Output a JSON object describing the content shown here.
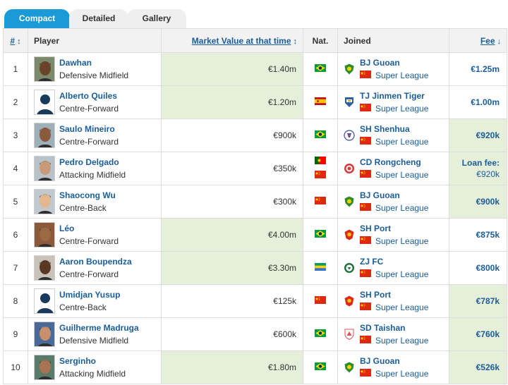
{
  "tabs": [
    {
      "label": "Compact"
    },
    {
      "label": "Detailed"
    },
    {
      "label": "Gallery"
    }
  ],
  "columns": {
    "num": "#",
    "player": "Player",
    "market_value": "Market Value at that time",
    "nat": "Nat.",
    "joined": "Joined",
    "fee": "Fee"
  },
  "sort_icons": {
    "num": "↕",
    "market_value": "↕",
    "fee": "↓"
  },
  "colors": {
    "accent": "#1a9bd7",
    "link": "#1a5d9a",
    "highlight": "#e5efd9",
    "header_bg": "#f2f2f2"
  },
  "rows": [
    {
      "num": "1",
      "name": "Dawhan",
      "position": "Defensive Midfield",
      "market_value": "€1.40m",
      "mv_hl": true,
      "nat": [
        "brazil"
      ],
      "club": "BJ Guoan",
      "crest": "guoan-crest",
      "league": "Super League",
      "fee": "€1.25m",
      "fee_hl": false
    },
    {
      "num": "2",
      "name": "Alberto Quiles",
      "position": "Centre-Forward",
      "market_value": "€1.20m",
      "mv_hl": true,
      "nat": [
        "spain"
      ],
      "club": "TJ Jinmen Tiger",
      "crest": "jinmen-tiger-crest",
      "league": "Super League",
      "fee": "€1.00m",
      "fee_hl": false
    },
    {
      "num": "3",
      "name": "Saulo Mineiro",
      "position": "Centre-Forward",
      "market_value": "€900k",
      "mv_hl": false,
      "nat": [
        "brazil"
      ],
      "club": "SH Shenhua",
      "crest": "shenhua-crest",
      "league": "Super League",
      "fee": "€920k",
      "fee_hl": true
    },
    {
      "num": "4",
      "name": "Pedro Delgado",
      "position": "Attacking Midfield",
      "market_value": "€350k",
      "mv_hl": false,
      "nat": [
        "portugal",
        "china"
      ],
      "club": "CD Rongcheng",
      "crest": "rongcheng-crest",
      "league": "Super League",
      "fee_label": "Loan fee:",
      "fee": "€920k",
      "fee_hl": true
    },
    {
      "num": "5",
      "name": "Shaocong Wu",
      "position": "Centre-Back",
      "market_value": "€300k",
      "mv_hl": false,
      "nat": [
        "china"
      ],
      "club": "BJ Guoan",
      "crest": "guoan-crest",
      "league": "Super League",
      "fee": "€900k",
      "fee_hl": true
    },
    {
      "num": "6",
      "name": "Léo",
      "position": "Centre-Forward",
      "market_value": "€4.00m",
      "mv_hl": true,
      "nat": [
        "brazil"
      ],
      "club": "SH Port",
      "crest": "sh-port-crest",
      "league": "Super League",
      "fee": "€875k",
      "fee_hl": false
    },
    {
      "num": "7",
      "name": "Aaron Boupendza",
      "position": "Centre-Forward",
      "market_value": "€3.30m",
      "mv_hl": true,
      "nat": [
        "gabon"
      ],
      "club": "ZJ FC",
      "crest": "zj-fc-crest",
      "league": "Super League",
      "fee": "€800k",
      "fee_hl": false
    },
    {
      "num": "8",
      "name": "Umidjan Yusup",
      "position": "Centre-Back",
      "market_value": "€125k",
      "mv_hl": false,
      "nat": [
        "china"
      ],
      "club": "SH Port",
      "crest": "sh-port-crest",
      "league": "Super League",
      "fee": "€787k",
      "fee_hl": true
    },
    {
      "num": "9",
      "name": "Guilherme Madruga",
      "position": "Defensive Midfield",
      "market_value": "€600k",
      "mv_hl": false,
      "nat": [
        "brazil"
      ],
      "club": "SD Taishan",
      "crest": "taishan-crest",
      "league": "Super League",
      "fee": "€760k",
      "fee_hl": true
    },
    {
      "num": "10",
      "name": "Serginho",
      "position": "Attacking Midfield",
      "market_value": "€1.80m",
      "mv_hl": true,
      "nat": [
        "brazil"
      ],
      "club": "BJ Guoan",
      "crest": "guoan-crest",
      "league": "Super League",
      "fee": "€526k",
      "fee_hl": true
    }
  ]
}
